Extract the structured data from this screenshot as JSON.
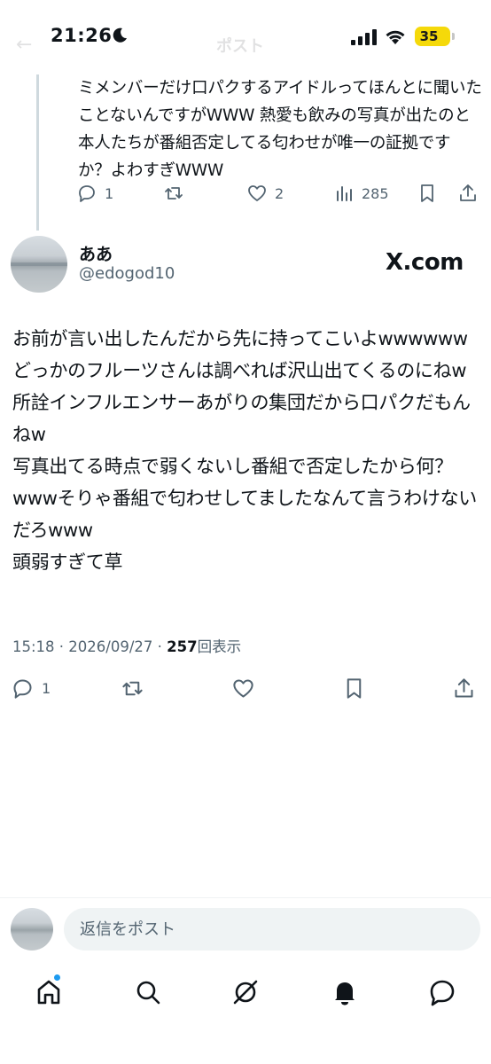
{
  "status_bar": {
    "time": "21:26",
    "battery": "35"
  },
  "header": {
    "back_icon": "back-arrow-icon",
    "title": "ポスト"
  },
  "parent_tweet": {
    "text": "ミメンバーだけ口パクするアイドルってほんとに聞いたことないんですがWWW 熱愛も飲みの写真が出たのと本人たちが番組否定してる匂わせが唯一の証拠ですか？よわすぎWWW",
    "replies": "1",
    "reposts": "",
    "likes": "2",
    "views": "285"
  },
  "main_tweet": {
    "author_name": "ああ",
    "author_handle": "@edogod10",
    "watermark": "X.com",
    "text": "お前が言い出したんだから先に持ってこいよwwwwww\nどっかのフルーツさんは調べれば沢山出てくるのにねw所詮インフルエンサーあがりの集団だから口パクだもんねw\n写真出てる時点で弱くないし番組で否定したから何？wwwそりゃ番組で匂わせしてましたなんて言うわけないだろwww\n頭弱すぎて草",
    "timestamp": "15:18 · 2026/09/27 · ",
    "view_count": "257",
    "view_label": "回表示",
    "replies": "1"
  },
  "reply_bar": {
    "placeholder": "返信をポスト"
  },
  "colors": {
    "text": "#0f1419",
    "muted": "#536471",
    "accent": "#1d9bf0",
    "battery": "#f5d90a"
  },
  "nav": [
    "home-icon",
    "search-icon",
    "grok-icon",
    "notifications-icon",
    "messages-icon"
  ]
}
